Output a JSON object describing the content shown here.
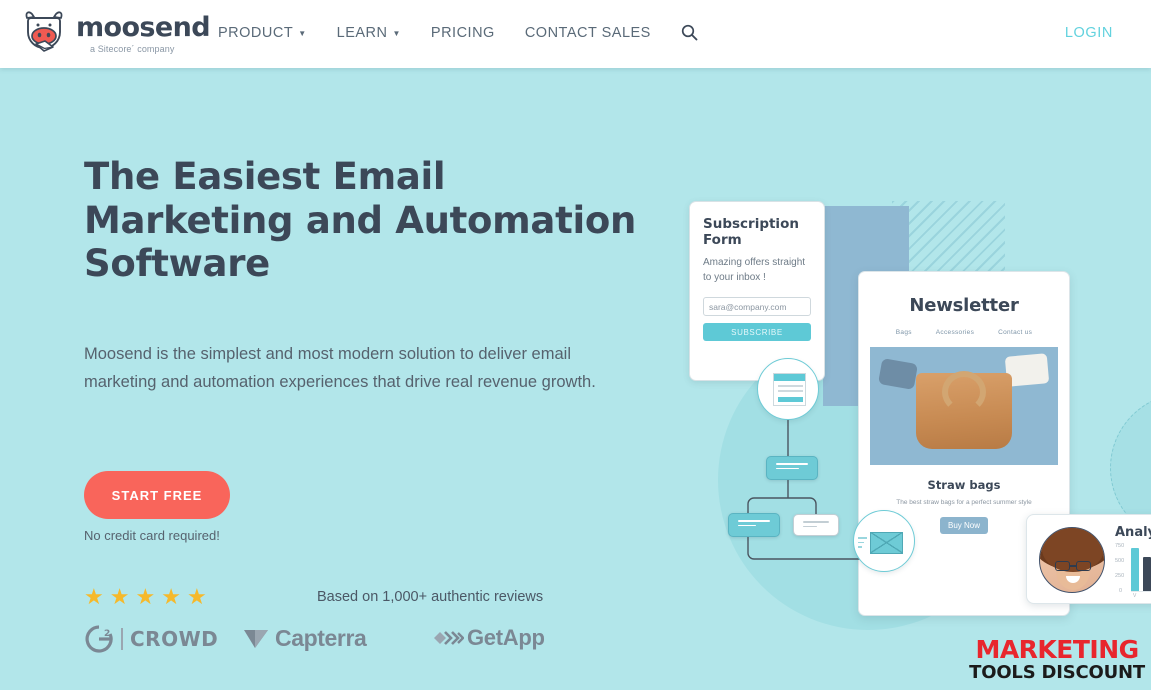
{
  "brand": {
    "logo_word": "moosend",
    "logo_tagline": "a Sitecore´ company",
    "logo_icon": "cow-head-envelope-icon"
  },
  "nav": {
    "items": [
      {
        "label": "PRODUCT",
        "has_dropdown": true
      },
      {
        "label": "LEARN",
        "has_dropdown": true
      },
      {
        "label": "PRICING",
        "has_dropdown": false
      },
      {
        "label": "CONTACT SALES",
        "has_dropdown": false
      }
    ],
    "search_icon": "search-icon",
    "login_label": "LOGIN",
    "login_color": "#62d2de"
  },
  "hero": {
    "title": "The Easiest Email Marketing and Automation Software",
    "subtitle": "Moosend is the simplest and most modern solution to deliver email marketing and automation experiences that drive real revenue growth.",
    "cta_label": "START FREE",
    "cta_color": "#f9655b",
    "cta_note": "No credit card required!",
    "background_color": "#b2e6ea",
    "title_color": "#3c4858"
  },
  "social_proof": {
    "star_count": 5,
    "star_glyph": "★",
    "star_color": "#f5b92b",
    "reviews_text": "Based on 1,000+ authentic reviews",
    "badges": [
      {
        "name": "g2-crowd-badge",
        "mark": "G",
        "sup": "2",
        "label": "CROWD"
      },
      {
        "name": "capterra-badge",
        "label": "Capterra"
      },
      {
        "name": "getapp-badge",
        "label": "GetApp"
      }
    ]
  },
  "illustration": {
    "subscription_form": {
      "title": "Subscription Form",
      "description": "Amazing offers straight to your inbox !",
      "email_value": "sara@company.com",
      "button_label": "SUBSCRIBE"
    },
    "newsletter": {
      "title": "Newsletter",
      "nav": [
        "Bags",
        "Accessories",
        "Contact us"
      ],
      "product_title": "Straw bags",
      "product_desc": "The best straw bags for a perfect summer style",
      "button_label": "Buy Now"
    },
    "analytics": {
      "title": "Analytics",
      "y_ticks": [
        "750",
        "500",
        "250",
        "0"
      ],
      "x_label": "V",
      "bars": [
        {
          "value": 700,
          "color": "#5ec9d6"
        },
        {
          "value": 560,
          "color": "#3c4858"
        }
      ]
    },
    "flow_nodes": [
      "form-node",
      "condition-node",
      "action-node-a",
      "action-node-b",
      "email-node"
    ]
  },
  "watermark": {
    "line1": "MARKETING",
    "line2": "TOOLS DISCOUNT",
    "line1_color": "#e8262d",
    "line2_color": "#1b1b1b"
  }
}
